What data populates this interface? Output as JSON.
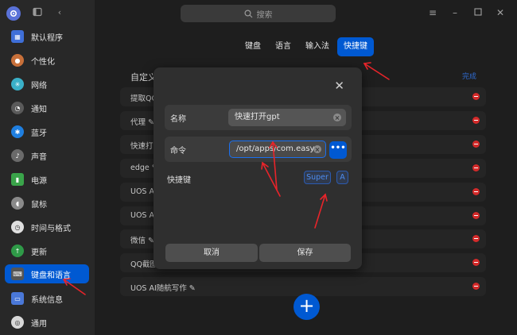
{
  "window": {
    "search_placeholder": "搜索"
  },
  "sidebar": {
    "items": [
      {
        "label": "默认程序",
        "icon": "default-apps-icon",
        "color": "#3f6fd8"
      },
      {
        "label": "个性化",
        "icon": "personalization-icon",
        "color": "#c8703a"
      },
      {
        "label": "网络",
        "icon": "network-icon",
        "color": "#3ab0c8"
      },
      {
        "label": "通知",
        "icon": "notification-icon",
        "color": "#5a5a5a"
      },
      {
        "label": "蓝牙",
        "icon": "bluetooth-icon",
        "color": "#1f7fe0"
      },
      {
        "label": "声音",
        "icon": "sound-icon",
        "color": "#6a6a6a"
      },
      {
        "label": "电源",
        "icon": "power-icon",
        "color": "#3aa44a"
      },
      {
        "label": "鼠标",
        "icon": "mouse-icon",
        "color": "#8a8a8a"
      },
      {
        "label": "时间与格式",
        "icon": "clock-icon",
        "color": "#e0e0e0"
      },
      {
        "label": "更新",
        "icon": "update-icon",
        "color": "#2f9a48"
      },
      {
        "label": "键盘和语言",
        "icon": "keyboard-icon",
        "color": "#555555"
      },
      {
        "label": "系统信息",
        "icon": "system-info-icon",
        "color": "#4a78d8"
      },
      {
        "label": "通用",
        "icon": "general-icon",
        "color": "#d8d8d8"
      }
    ],
    "active_index": 10
  },
  "tabs": [
    {
      "label": "键盘",
      "active": false
    },
    {
      "label": "语言",
      "active": false
    },
    {
      "label": "输入法",
      "active": false
    },
    {
      "label": "快捷键",
      "active": true
    }
  ],
  "custom_list": {
    "heading": "自定义",
    "edit_label": "完成",
    "rows": [
      "提取QQ",
      "代理 ✎",
      "快速打开",
      "edge ✎",
      "UOS AI",
      "UOS AI",
      "微信 ✎",
      "QQ截图",
      "UOS AI随航写作 ✎"
    ]
  },
  "dialog": {
    "name_label": "名称",
    "name_value": "快速打开gpt",
    "command_label": "命令",
    "command_value": "/opt/apps/com.easy;",
    "more_label": "•••",
    "shortcut_label": "快捷键",
    "keys": [
      "Super",
      "A"
    ],
    "cancel_label": "取消",
    "save_label": "保存",
    "close_label": "✕"
  },
  "colors": {
    "accent": "#0059d2",
    "annotation": "#e8242a",
    "delete": "#d32a2a"
  }
}
